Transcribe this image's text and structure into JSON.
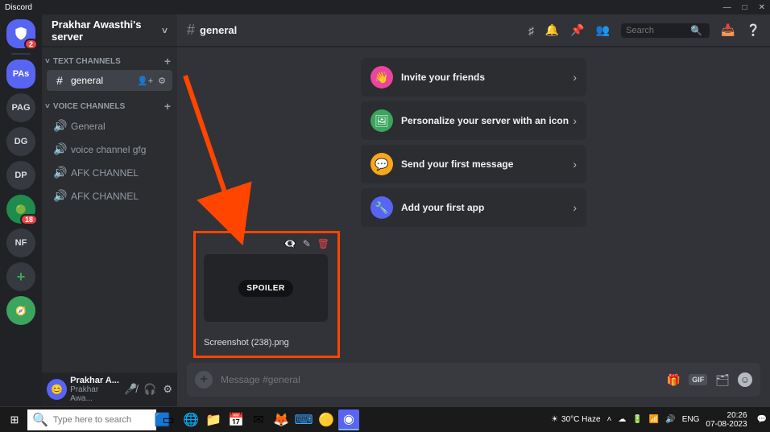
{
  "app_title": "Discord",
  "server_name": "Prakhar Awasthi's server",
  "channel_header": "general",
  "search_placeholder": "Search",
  "categories": {
    "text_label": "TEXT CHANNELS",
    "voice_label": "VOICE CHANNELS"
  },
  "text_channels": [
    "general"
  ],
  "voice_channels": [
    "General",
    "voice channel gfg",
    "AFK CHANNEL",
    "AFK CHANNEL"
  ],
  "guilds": {
    "pas": "PAs",
    "pag": "PAG",
    "dg": "DG",
    "dp": "DP",
    "nf": "NF",
    "badge_2": "2",
    "badge_18": "18"
  },
  "welcome_cards": [
    {
      "label": "Invite your friends",
      "color": "#eb459e"
    },
    {
      "label": "Personalize your server with an icon",
      "color": "#3ba55d"
    },
    {
      "label": "Send your first message",
      "color": "#faa61a"
    },
    {
      "label": "Add your first app",
      "color": "#5865f2"
    }
  ],
  "attachment": {
    "spoiler_label": "SPOILER",
    "filename": "Screenshot (238).png"
  },
  "message_placeholder": "Message #general",
  "user_panel": {
    "name": "Prakhar A...",
    "tag": "Prakhar Awa..."
  },
  "taskbar": {
    "search_placeholder": "Type here to search",
    "weather": "30°C Haze",
    "lang": "ENG",
    "time": "20:26",
    "date": "07-08-2023"
  },
  "gif_label": "GIF"
}
